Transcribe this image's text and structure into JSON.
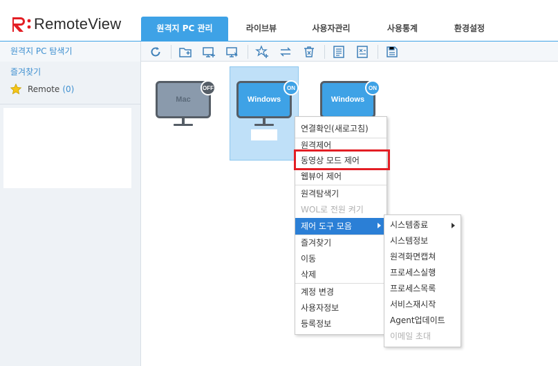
{
  "app": {
    "logo_text": "RemoteView",
    "brand_color": "#e31e24",
    "accent_color": "#3ea2e6"
  },
  "tabs": [
    {
      "label": "원격지 PC 관리",
      "active": true
    },
    {
      "label": "라이브뷰",
      "active": false
    },
    {
      "label": "사용자관리",
      "active": false
    },
    {
      "label": "사용통계",
      "active": false
    },
    {
      "label": "환경설정",
      "active": false
    }
  ],
  "sidebar": {
    "title": "원격지 PC 탐색기",
    "favorites_title": "즐겨찾기",
    "favorite_item": {
      "label": "Remote",
      "count": "(0)",
      "icon": "star-icon"
    }
  },
  "toolbar": {
    "icons": [
      "refresh-icon",
      "new-folder-icon",
      "add-pc-icon",
      "remote-control-icon",
      "add-favorite-icon",
      "move-icon",
      "delete-icon",
      "properties-icon",
      "export-icon",
      "save-icon"
    ]
  },
  "pcs": [
    {
      "label": "Mac",
      "status": "OFF",
      "selected": false,
      "color": "#8a9aac"
    },
    {
      "label": "Windows",
      "status": "ON",
      "selected": true,
      "color": "#3ea2e6"
    },
    {
      "label": "Windows",
      "status": "ON",
      "selected": false,
      "color": "#3ea2e6"
    }
  ],
  "context_menu": {
    "items": [
      {
        "label": "연결확인(새로고침)"
      },
      {
        "label": "원격제어"
      },
      {
        "label": "동영상 모드 제어"
      },
      {
        "label": "웹뷰어 제어"
      },
      {
        "label": "원격탐색기"
      },
      {
        "label": "WOL로 전원 켜기",
        "disabled": true
      },
      {
        "label": "제어 도구 모음",
        "active": true
      },
      {
        "label": "즐겨찾기"
      },
      {
        "label": "이동"
      },
      {
        "label": "삭제"
      },
      {
        "label": "계정 변경"
      },
      {
        "label": "사용자정보"
      },
      {
        "label": "등록정보"
      }
    ]
  },
  "submenu": {
    "items": [
      {
        "label": "시스템종료",
        "has_submenu": true
      },
      {
        "label": "시스템정보"
      },
      {
        "label": "원격화면캡쳐"
      },
      {
        "label": "프로세스실행"
      },
      {
        "label": "프로세스목록"
      },
      {
        "label": "서비스재시작"
      },
      {
        "label": "Agent업데이트"
      },
      {
        "label": "이메일 초대",
        "disabled": true
      }
    ]
  }
}
